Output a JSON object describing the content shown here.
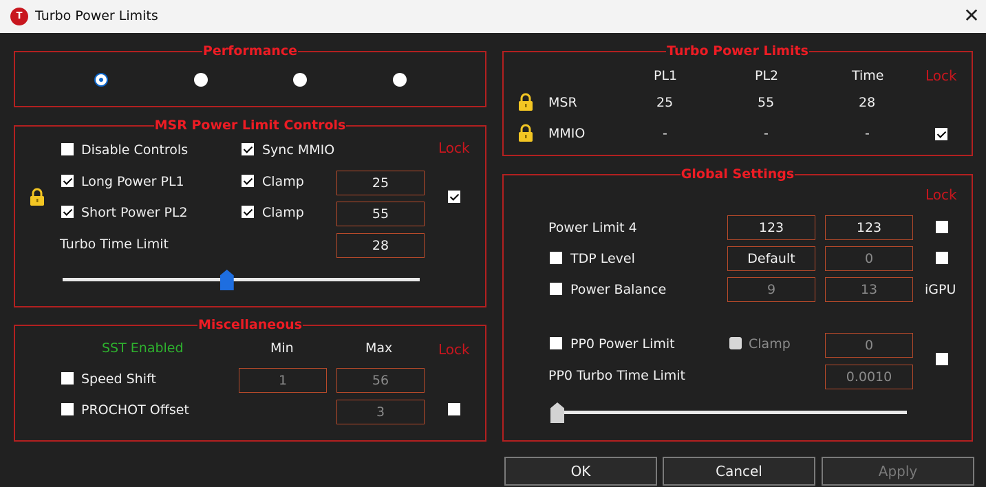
{
  "window": {
    "title": "Turbo Power Limits",
    "icon_letter": "T",
    "close_glyph": "✕"
  },
  "performance": {
    "title": "Performance",
    "radios": [
      true,
      false,
      false,
      false
    ]
  },
  "msr": {
    "title": "MSR Power Limit Controls",
    "lock_label": "Lock",
    "disable_controls": {
      "label": "Disable Controls",
      "checked": false
    },
    "sync_mmio": {
      "label": "Sync MMIO",
      "checked": true
    },
    "long_power": {
      "label": "Long Power PL1",
      "checked": true,
      "clamp_label": "Clamp",
      "clamp_checked": true,
      "value": "25"
    },
    "short_power": {
      "label": "Short Power PL2",
      "checked": true,
      "clamp_label": "Clamp",
      "clamp_checked": true,
      "value": "55"
    },
    "turbo_time": {
      "label": "Turbo Time Limit",
      "value": "28"
    },
    "lock_checked": true,
    "slider_fraction": 0.46
  },
  "misc": {
    "title": "Miscellaneous",
    "sst": "SST Enabled",
    "min_label": "Min",
    "max_label": "Max",
    "lock_label": "Lock",
    "speed_shift": {
      "label": "Speed Shift",
      "checked": false,
      "min": "1",
      "max": "56"
    },
    "prochot": {
      "label": "PROCHOT Offset",
      "checked": false,
      "value": "3"
    },
    "lock_checked": false
  },
  "tpl": {
    "title": "Turbo Power Limits",
    "headers": {
      "pl1": "PL1",
      "pl2": "PL2",
      "time": "Time",
      "lock": "Lock"
    },
    "msr": {
      "label": "MSR",
      "pl1": "25",
      "pl2": "55",
      "time": "28"
    },
    "mmio": {
      "label": "MMIO",
      "pl1": "-",
      "pl2": "-",
      "time": "-",
      "lock_checked": true
    }
  },
  "global": {
    "title": "Global Settings",
    "lock_label": "Lock",
    "power_limit_4": {
      "label": "Power Limit 4",
      "v1": "123",
      "v2": "123",
      "lock_checked": false
    },
    "tdp_level": {
      "label": "TDP Level",
      "checked": false,
      "v1": "Default",
      "v2": "0",
      "lock_checked": false
    },
    "power_balance": {
      "label": "Power Balance",
      "checked": false,
      "v1": "9",
      "v2": "13",
      "igpu": "iGPU"
    },
    "pp0_power_limit": {
      "label": "PP0 Power Limit",
      "checked": false,
      "clamp_label": "Clamp",
      "value": "0",
      "lock_checked": false
    },
    "pp0_turbo_time": {
      "label": "PP0 Turbo Time Limit",
      "value": "0.0010"
    },
    "slider_fraction": 0.0
  },
  "buttons": {
    "ok": "OK",
    "cancel": "Cancel",
    "apply": "Apply"
  },
  "colors": {
    "accent_red": "#ed1c24",
    "lock_red": "#c8161e",
    "sst_green": "#2eb22e",
    "border_red": "#b32020",
    "radio_blue": "#0a64c8"
  }
}
